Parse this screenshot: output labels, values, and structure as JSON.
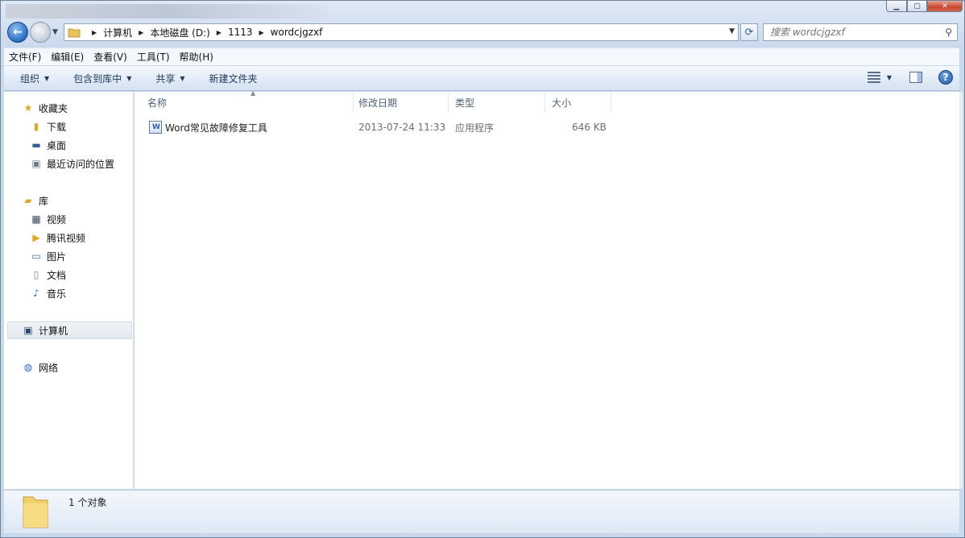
{
  "window": {
    "min_label": "▁",
    "max_label": "▢",
    "close_label": "✕"
  },
  "nav": {
    "back_label": "←",
    "fwd_label": "→",
    "breadcrumbs": [
      "计算机",
      "本地磁盘 (D:)",
      "1113",
      "wordcjgzxf"
    ],
    "search_placeholder": "搜索 wordcjgzxf"
  },
  "menu": [
    "文件(F)",
    "编辑(E)",
    "查看(V)",
    "工具(T)",
    "帮助(H)"
  ],
  "toolbar": {
    "organize": "组织",
    "include_library": "包含到库中",
    "share": "共享",
    "new_folder": "新建文件夹"
  },
  "sidebar": {
    "favorites": "收藏夹",
    "favorites_items": [
      "下载",
      "桌面",
      "最近访问的位置"
    ],
    "libraries": "库",
    "library_items": [
      "视频",
      "腾讯视频",
      "图片",
      "文档",
      "音乐"
    ],
    "computer": "计算机",
    "network": "网络"
  },
  "columns": {
    "name": "名称",
    "date": "修改日期",
    "type": "类型",
    "size": "大小"
  },
  "files": [
    {
      "name": "Word常见故障修复工具",
      "date": "2013-07-24 11:33",
      "type": "应用程序",
      "size": "646 KB"
    }
  ],
  "status": {
    "count": "1 个对象"
  },
  "colors": {
    "accent": "#1e395b",
    "selection": "#e3e8ee"
  }
}
